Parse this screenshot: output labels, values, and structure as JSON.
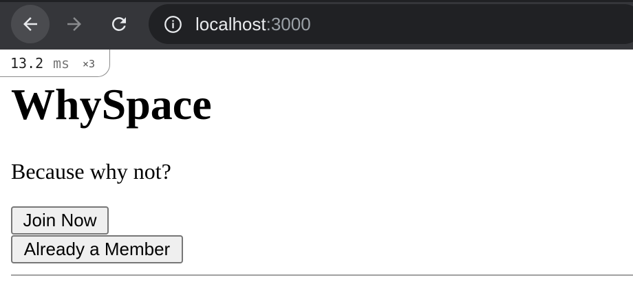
{
  "browser": {
    "url_host": "localhost",
    "url_port": ":3000",
    "icons": {
      "back": "arrow-left-icon",
      "forward": "arrow-right-icon",
      "reload": "reload-icon",
      "site_info": "info-icon"
    }
  },
  "timing_badge": {
    "value": "13.2",
    "unit": "ms",
    "multiplier": "×3"
  },
  "page": {
    "title": "WhySpace",
    "tagline": "Because why not?",
    "join_label": "Join Now",
    "member_label": "Already a Member"
  }
}
